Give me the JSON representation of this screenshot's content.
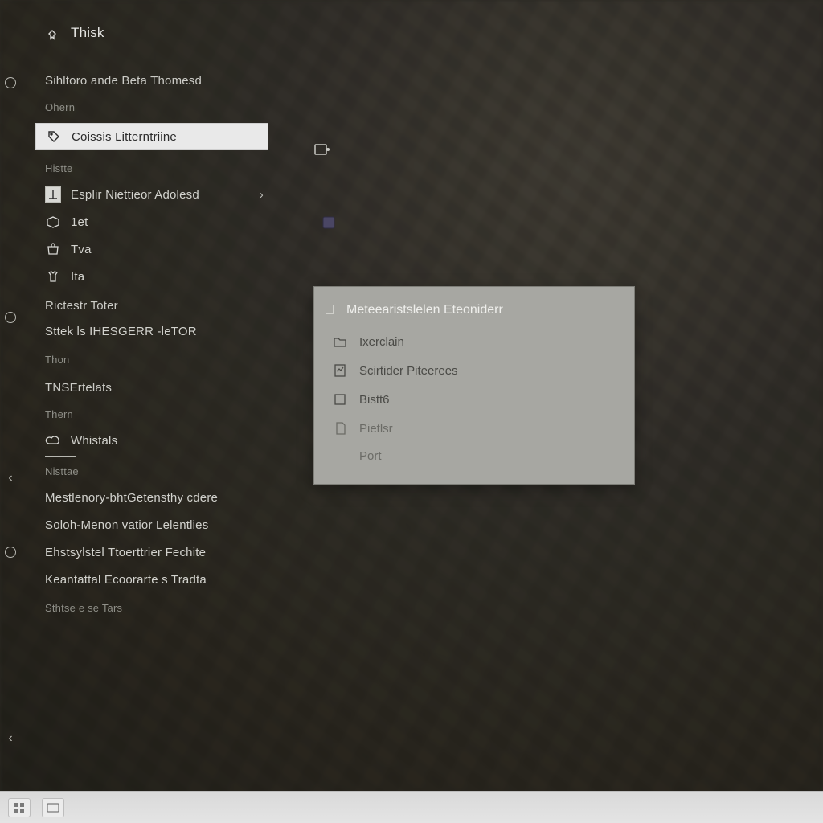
{
  "menu": {
    "title": "Thisk",
    "heading": "Sihltoro ande Beta Thomesd",
    "heading_sub": "Ohern",
    "pinned": {
      "label": "Coissis Litterntriine"
    },
    "history_label": "Histte",
    "recent": {
      "label": "Esplir Niettieor Adolesd"
    },
    "quick": [
      {
        "label": "1et"
      },
      {
        "label": "Tva"
      },
      {
        "label": "Ita"
      }
    ],
    "sections": [
      {
        "heading": "Rictestr Toter",
        "item": "Sttek ls IHESGERR -leTOR",
        "sub": "Thon"
      },
      {
        "heading": "TNSErtelats",
        "sub": "Thern",
        "item": "Whistals",
        "footer": "Nisttae"
      }
    ],
    "bottom": [
      "Mestlenory-bhtGetensthy cdere",
      "Soloh-Menon vatior Lelentlies",
      "Ehstsylstel Ttoerttrier Fechite",
      "Keantattal Ecoorarte s Tradta",
      "Sthtse e se Tars"
    ]
  },
  "contextMenu": {
    "title": "Meteearistslelen Eteoniderr",
    "items": [
      {
        "label": "Ixerclain",
        "icon": "folder-icon"
      },
      {
        "label": "Scirtider Piteerees",
        "icon": "document-icon"
      },
      {
        "label": "Bistt6",
        "icon": "square-icon"
      },
      {
        "label": "Pietlsr",
        "icon": "page-icon"
      },
      {
        "label": "Port",
        "icon": null
      }
    ]
  },
  "colors": {
    "bg": "#2a2822",
    "panelHighlight": "#e9e9e9",
    "popup": "#a7a7a2"
  }
}
